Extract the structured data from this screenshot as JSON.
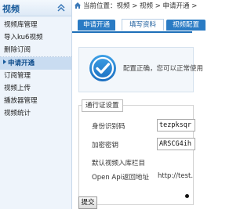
{
  "sidebar": {
    "title": "视频",
    "collapse_icon": "double-chevron-up-icon",
    "items": [
      {
        "label": "视频库管理",
        "active": false
      },
      {
        "label": "导入ku6视频",
        "active": false
      },
      {
        "label": "删除订阅",
        "active": false
      },
      {
        "label": "申请开通",
        "active": true
      },
      {
        "label": "订阅管理",
        "active": false
      },
      {
        "label": "视频上传",
        "active": false
      },
      {
        "label": "播放器管理",
        "active": false
      },
      {
        "label": "视频统计",
        "active": false
      }
    ]
  },
  "breadcrumb": {
    "icon": "home-icon",
    "text": "当前位置：视频 > 视频 > 申请开通 >"
  },
  "tabs": [
    {
      "label": "申请开通",
      "active": true
    },
    {
      "label": "填写资料",
      "active": false
    },
    {
      "label": "视频配置",
      "active": false
    }
  ],
  "notice": {
    "icon": "check-circle-icon",
    "text": "配置正确，您可以正常使用"
  },
  "form": {
    "legend": "通行证设置",
    "id_label": "身份识别码",
    "id_value": "tezpksqr",
    "key_label": "加密密钥",
    "key_value": "ARSCG4ih",
    "import_label": "默认视频入库栏目",
    "api_label": "Open Api返回地址",
    "api_value": "http://test."
  },
  "submit_label": "提交",
  "colors": {
    "accent": "#2a7bc4",
    "sidebar_bg": "#eef4fb",
    "check_gradient_start": "#3ea0e6",
    "check_gradient_end": "#1c6fc0"
  }
}
